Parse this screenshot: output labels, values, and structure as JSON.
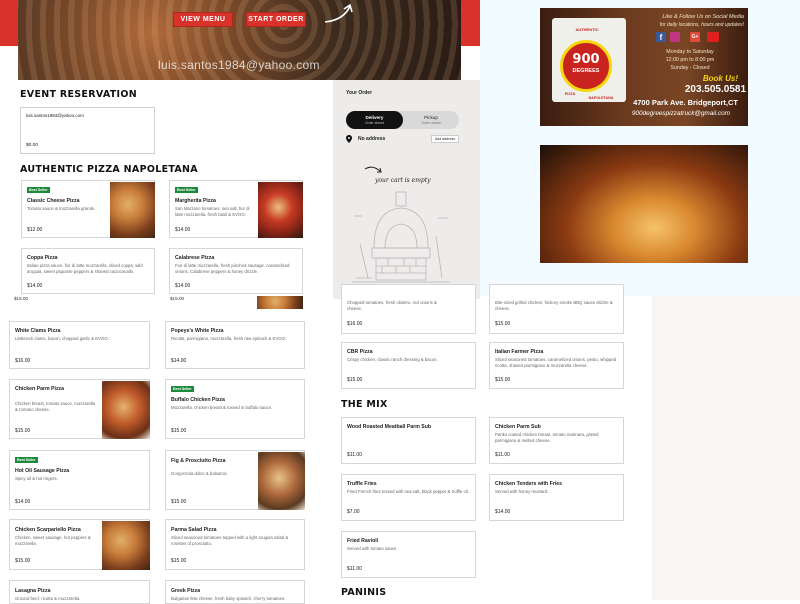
{
  "hero": {
    "view_menu": "VIEW MENU",
    "start_order": "START ORDER",
    "email_overlay": "luis.santos1984@yahoo.com"
  },
  "event_reservation": {
    "title": "EVENT RESERVATION",
    "email": "luis.santos1984@yahoo.com",
    "price": "$0.00"
  },
  "napoletana": {
    "title": "AUTHENTIC PIZZA NAPOLETANA",
    "items": [
      {
        "badge": "Best Seller",
        "name": "Classic Cheese Pizza",
        "desc": "Tomato sauce & mozzarella grande.",
        "price": "$12.00"
      },
      {
        "badge": "Best Seller",
        "name": "Margherita Pizza",
        "desc": "San Marzano tomatoes, sea salt, fior di latte mozzarella, fresh basil & EVOO.",
        "price": "$14.00"
      },
      {
        "name": "Coppa Pizza",
        "desc": "Italian pizza sauce, fior di latte mozzarella, sliced coppa, wild arugula, sweet piquante peppers & shaved caciocavallo.",
        "price": "$14.00"
      },
      {
        "name": "Calabrese Pizza",
        "desc": "Fior di latte mozzarella, fresh pinched sausage, caramelized onions, Calabrese peppers & honey drizzle.",
        "price": "$14.00"
      }
    ]
  },
  "order": {
    "title": "Your Order",
    "delivery": "Delivery",
    "delivery_sub": "Order ahead",
    "pickup": "Pickup",
    "pickup_sub": "Order ahead",
    "no_address": "No address",
    "add_address": "Add address",
    "empty_cart": "your cart is empty"
  },
  "lower_left": {
    "partial_price_1": "$15.00",
    "partial_price_2": "$15.00",
    "items": [
      {
        "name": "White Clams Pizza",
        "desc": "Littleneck clams, bacon, chopped garlic & EVOO.",
        "price": "$16.00"
      },
      {
        "name": "Popeye's White Pizza",
        "desc": "Ricotta, parmigiano, mozzarella, fresh raw spinach & EVOO.",
        "price": "$14.00"
      },
      {
        "name": "Chicken Parm Pizza",
        "desc": "Chicken breast, tomato sauce, mozzarella & romano cheese.",
        "price": "$15.00"
      },
      {
        "badge": "Best Seller",
        "name": "Buffalo Chicken Pizza",
        "desc": "Mozzarella, chicken breast & tossed in buffalo sauce.",
        "price": "$15.00"
      },
      {
        "badge": "Best Seller",
        "name": "Hot Oil Sausage Pizza",
        "desc": "Spicy oil & hot ringers.",
        "price": "$14.00"
      },
      {
        "name": "Fig & Prosciutto Pizza",
        "desc": "Gorgonzola dolce & balsamic.",
        "price": "$15.00"
      },
      {
        "name": "Chicken Scarpariello Pizza",
        "desc": "Chicken, sweet sausage, hot peppers & mozzarella.",
        "price": "$15.00"
      },
      {
        "name": "Parma Salad Pizza",
        "desc": "Sliced seasoned tomatoes topped with a light arugula salad & rosettes of prosciutto.",
        "price": "$15.00"
      },
      {
        "name": "Lasagna Pizza",
        "desc": "Ground beef, ricotta & mozzarella."
      },
      {
        "name": "Greek Pizza",
        "desc": "Bulgarian feta cheese, fresh baby spinach, cherry tomatoes."
      }
    ]
  },
  "lower_right": {
    "top_items": [
      {
        "desc": "Chopped tomatoes, fresh cilantro, red onions & cheese.",
        "price": "$16.00"
      },
      {
        "desc": "Bite-sized grilled chicken, hickory smoke BBQ sauce drizzle & cheese.",
        "price": "$15.00"
      },
      {
        "name": "CBR Pizza",
        "desc": "Crispy chicken, classic ranch dressing & bacon.",
        "price": "$15.00"
      },
      {
        "name": "Italian Farmer Pizza",
        "desc": "Sliced seasoned tomatoes, caramelized onions, pesto, whipped ricotta, shaved parmigiano & mozzarella cheese.",
        "price": "$15.00"
      }
    ],
    "the_mix_title": "THE MIX",
    "mix_items": [
      {
        "name": "Wood Roasted Meatball Parm Sub",
        "desc": "",
        "price": "$11.00"
      },
      {
        "name": "Chicken Parm Sub",
        "desc": "Panko coated chicken breast, tomato marinara, grated parmigiano & melted cheese.",
        "price": "$11.00"
      },
      {
        "name": "Truffle Fries",
        "desc": "Fried French fries tossed with sea salt, black pepper & truffle oil.",
        "price": "$7.00"
      },
      {
        "name": "Chicken Tenders with Fries",
        "desc": "Served with honey mustard.",
        "price": "$14.00"
      },
      {
        "name": "Fried Ravioli",
        "desc": "Served with tomato sauce.",
        "price": "$11.00"
      }
    ],
    "paninis_title": "PANINIS"
  },
  "ad": {
    "follow": "Like & Follow Us on Social Media",
    "follow2": "for daily locations, hours and updates!",
    "hours1": "Monday to Saturday",
    "hours2": "12:00 pm to 8:00 pm",
    "hours3": "Sunday - Closed",
    "book": "Book Us!",
    "phone": "203.505.0581",
    "address": "4700 Park Ave. Bridgeport,CT",
    "website": "900degreespizzatruck@gmail.com",
    "logo_number": "900",
    "logo_word": "DEGREES",
    "logo_ring_top": "AUTHENTIC",
    "logo_ring_left": "PIZZA",
    "logo_ring_bottom": "NAPOLETANA"
  }
}
